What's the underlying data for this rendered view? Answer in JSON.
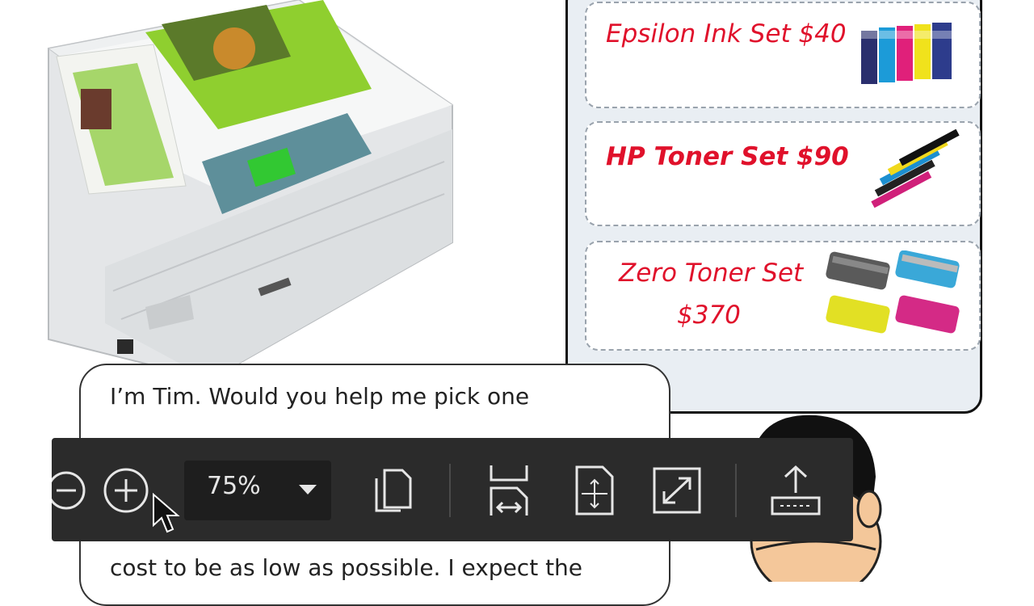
{
  "offers": [
    {
      "label": "Epsilon Ink Set $40",
      "icon": "ink-cartridges-icon"
    },
    {
      "label": "HP Toner Set $90",
      "icon": "toner-sticks-icon"
    },
    {
      "label_line1": "Zero Toner Set",
      "label_line2": "$370",
      "icon": "toner-cartridges-icon"
    }
  ],
  "bubble": {
    "line1": "I’m Tim. Would you help me pick one",
    "line3": "cost to be as low as possible. I expect the"
  },
  "toolbar": {
    "zoom_value": "75%",
    "buttons": [
      "zoom-out",
      "zoom-in",
      "zoom-dropdown",
      "copy",
      "fit-width",
      "fit-page",
      "full-screen",
      "export"
    ]
  },
  "colors": {
    "offer_text": "#e0112b",
    "toolbar_bg": "#2b2b2b",
    "panel_bg": "#e9eef3"
  }
}
